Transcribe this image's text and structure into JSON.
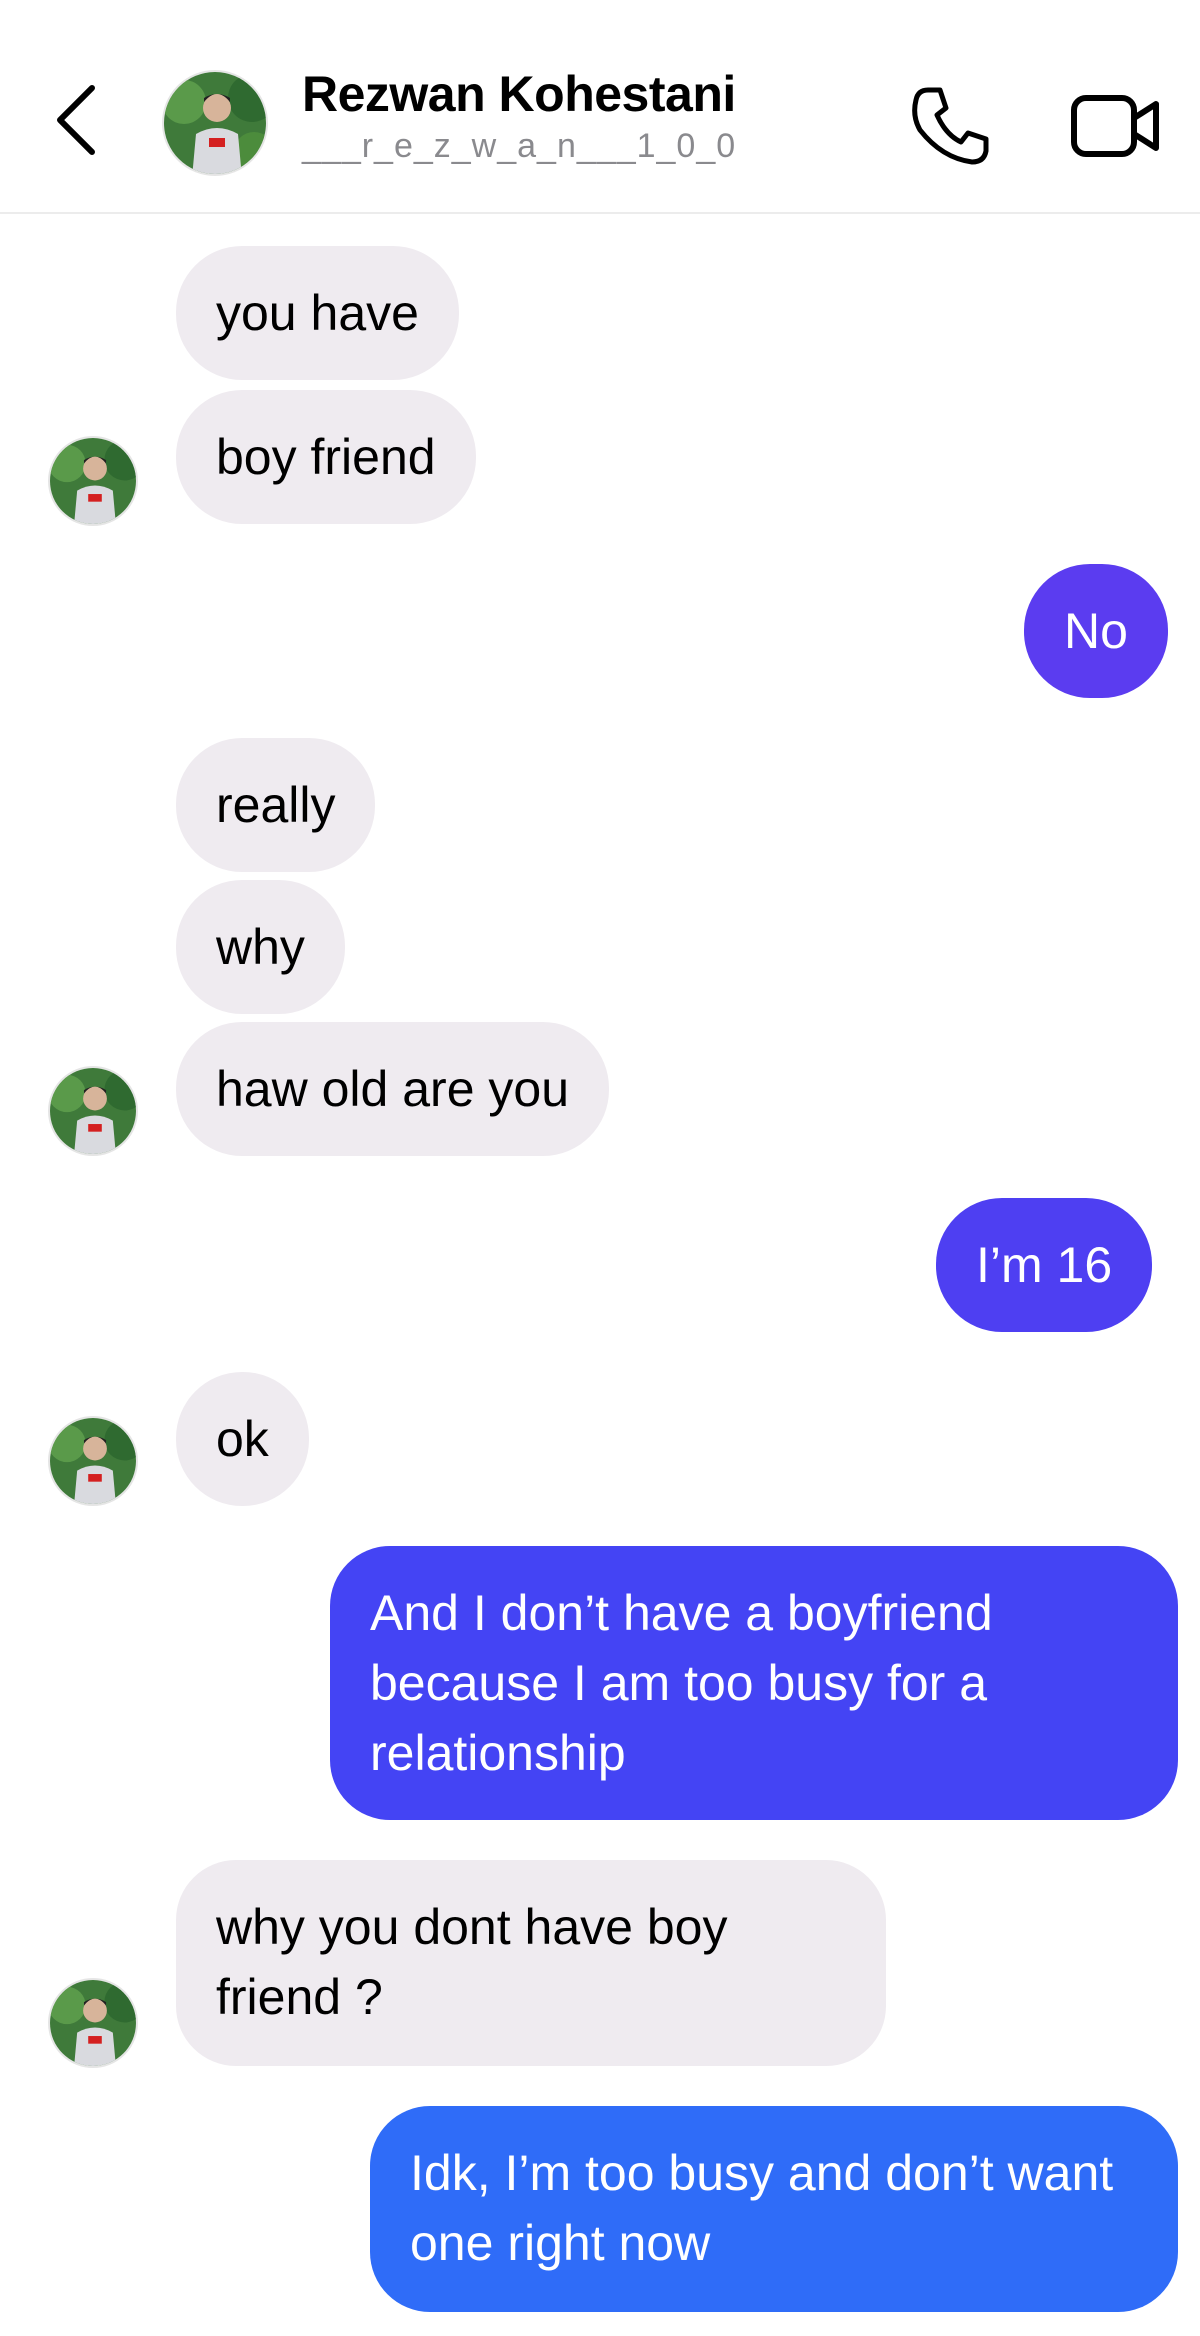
{
  "header": {
    "contact_name": "Rezwan Kohestani",
    "username": "___r_e_z_w_a_n___1_0_0",
    "icons": [
      "back-chevron-icon",
      "phone-icon",
      "video-camera-icon"
    ]
  },
  "colors": {
    "received_bubble": "#efebf0",
    "sent_purple": "#5b3cf0",
    "sent_blue": "#2f6cf8",
    "divider": "#ececec"
  },
  "messages": [
    {
      "from": "them",
      "text": "you have"
    },
    {
      "from": "them",
      "text": "boy friend"
    },
    {
      "from": "me",
      "text": "No"
    },
    {
      "from": "them",
      "text": "really"
    },
    {
      "from": "them",
      "text": "why"
    },
    {
      "from": "them",
      "text": "haw old are you"
    },
    {
      "from": "me",
      "text": "I’m 16"
    },
    {
      "from": "them",
      "text": "ok"
    },
    {
      "from": "me",
      "text": "And I don’t have a boyfriend because I am too busy for a relationship"
    },
    {
      "from": "them",
      "text": "why you dont have boy friend ?"
    },
    {
      "from": "me",
      "text": "Idk, I’m too busy and don’t want one right now"
    }
  ]
}
